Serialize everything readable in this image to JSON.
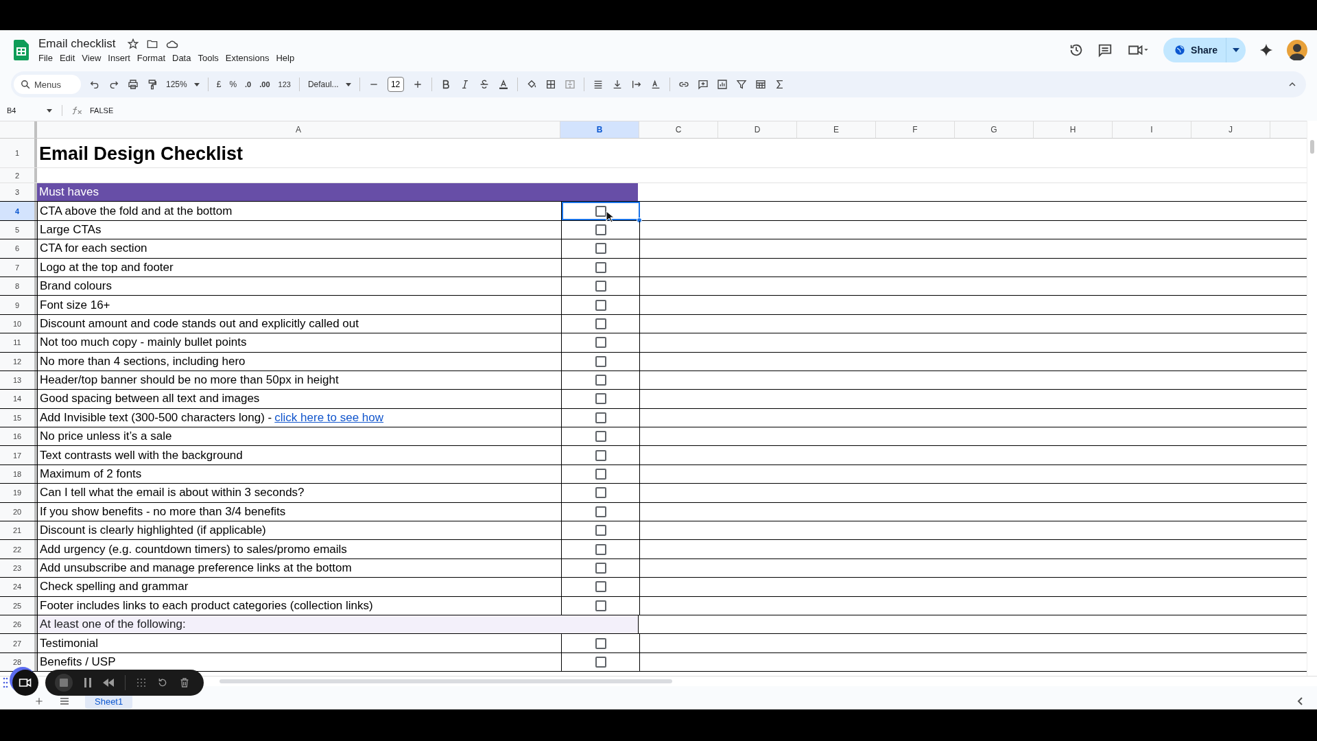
{
  "document": {
    "title": "Email checklist"
  },
  "menu": [
    "File",
    "Edit",
    "View",
    "Insert",
    "Format",
    "Data",
    "Tools",
    "Extensions",
    "Help"
  ],
  "share": {
    "label": "Share"
  },
  "toolbar": {
    "search_placeholder": "Menus",
    "zoom": "125%",
    "currency": "£",
    "percent": "%",
    "decrease_decimals": ".0",
    "increase_decimals": ".00",
    "number_format": "123",
    "font": "Defaul...",
    "font_size": "12"
  },
  "formula_bar": {
    "cell": "B4",
    "value": "FALSE"
  },
  "columns": [
    {
      "label": "A",
      "selected": false
    },
    {
      "label": "B",
      "selected": true
    },
    {
      "label": "C",
      "selected": false
    },
    {
      "label": "D",
      "selected": false
    },
    {
      "label": "E",
      "selected": false
    },
    {
      "label": "F",
      "selected": false
    },
    {
      "label": "G",
      "selected": false
    },
    {
      "label": "H",
      "selected": false
    },
    {
      "label": "I",
      "selected": false
    },
    {
      "label": "J",
      "selected": false
    }
  ],
  "rows": [
    {
      "number": "1",
      "kind": "title",
      "text": "Email Design Checklist",
      "selected": false
    },
    {
      "number": "2",
      "kind": "blank",
      "selected": false
    },
    {
      "number": "3",
      "kind": "section",
      "text": "Must haves",
      "selected": false
    },
    {
      "number": "4",
      "kind": "item",
      "text": "CTA above the fold and at the bottom",
      "checked": false,
      "selected": true
    },
    {
      "number": "5",
      "kind": "item",
      "text": "Large CTAs",
      "checked": false,
      "selected": false
    },
    {
      "number": "6",
      "kind": "item",
      "text": "CTA for each section",
      "checked": false,
      "selected": false
    },
    {
      "number": "7",
      "kind": "item",
      "text": "Logo at the top and footer",
      "checked": false,
      "selected": false
    },
    {
      "number": "8",
      "kind": "item",
      "text": "Brand colours",
      "checked": false,
      "selected": false
    },
    {
      "number": "9",
      "kind": "item",
      "text": "Font size 16+",
      "checked": false,
      "selected": false
    },
    {
      "number": "10",
      "kind": "item",
      "text": "Discount amount and code stands out and explicitly called out",
      "checked": false,
      "selected": false
    },
    {
      "number": "11",
      "kind": "item",
      "text": "Not too much copy - mainly bullet points",
      "checked": false,
      "selected": false
    },
    {
      "number": "12",
      "kind": "item",
      "text": "No more than 4 sections, including hero",
      "checked": false,
      "selected": false
    },
    {
      "number": "13",
      "kind": "item",
      "text": "Header/top banner should be no more than 50px in height",
      "checked": false,
      "selected": false
    },
    {
      "number": "14",
      "kind": "item",
      "text": "Good spacing between all text and images",
      "checked": false,
      "selected": false
    },
    {
      "number": "15",
      "kind": "item",
      "text": "Add Invisible text (300-500 characters long) - ",
      "link": "click here to see how",
      "checked": false,
      "selected": false
    },
    {
      "number": "16",
      "kind": "item",
      "text": "No price unless it’s a sale",
      "checked": false,
      "selected": false
    },
    {
      "number": "17",
      "kind": "item",
      "text": "Text contrasts well with the background",
      "checked": false,
      "selected": false
    },
    {
      "number": "18",
      "kind": "item",
      "text": "Maximum of 2 fonts",
      "checked": false,
      "selected": false
    },
    {
      "number": "19",
      "kind": "item",
      "text": "Can I tell what the email is about within 3 seconds?",
      "checked": false,
      "selected": false
    },
    {
      "number": "20",
      "kind": "item",
      "text": "If you show benefits - no more than 3/4 benefits",
      "checked": false,
      "selected": false
    },
    {
      "number": "21",
      "kind": "item",
      "text": "Discount is clearly highlighted (if applicable)",
      "checked": false,
      "selected": false
    },
    {
      "number": "22",
      "kind": "item",
      "text": "Add urgency (e.g. countdown timers) to sales/promo emails",
      "checked": false,
      "selected": false
    },
    {
      "number": "23",
      "kind": "item",
      "text": "Add unsubscribe and manage preference links at the bottom",
      "checked": false,
      "selected": false
    },
    {
      "number": "24",
      "kind": "item",
      "text": "Check spelling and grammar",
      "checked": false,
      "selected": false
    },
    {
      "number": "25",
      "kind": "item",
      "text": "Footer includes links to each product categories (collection links)",
      "checked": false,
      "selected": false
    },
    {
      "number": "26",
      "kind": "subsection",
      "text": "At least one of the following:",
      "selected": false
    },
    {
      "number": "27",
      "kind": "item",
      "text": "Testimonial",
      "checked": false,
      "selected": false
    },
    {
      "number": "28",
      "kind": "item",
      "text": "Benefits / USP",
      "checked": false,
      "selected": false
    }
  ],
  "sheets": [
    {
      "label": "Sheet1",
      "selected": true
    }
  ]
}
